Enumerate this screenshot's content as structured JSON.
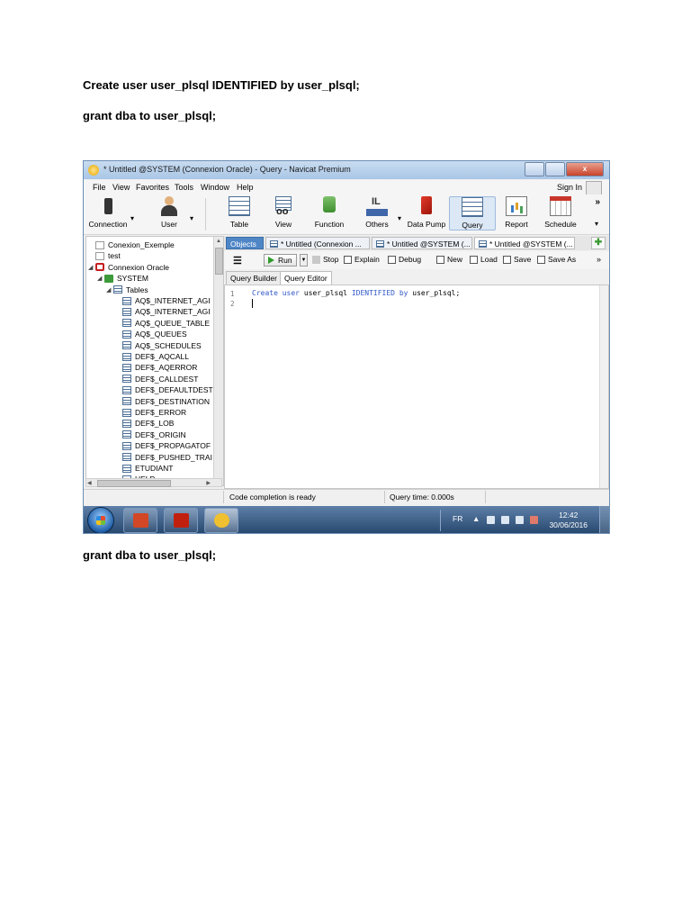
{
  "document": {
    "line1": "Create user user_plsql IDENTIFIED by user_plsql;",
    "line2": "grant dba to user_plsql;",
    "line3": "grant dba to user_plsql;"
  },
  "window": {
    "title": "* Untitled @SYSTEM (Connexion Oracle) - Query - Navicat Premium",
    "minimize": "",
    "maximize": "",
    "close": "x"
  },
  "menu": [
    "File",
    "View",
    "Favorites",
    "Tools",
    "Window",
    "Help"
  ],
  "signin": "Sign In",
  "more": "»",
  "toolbar": [
    "Connection",
    "User",
    "Table",
    "View",
    "Function",
    "Others",
    "Data Pump",
    "Query",
    "Report",
    "Schedule"
  ],
  "tree": [
    {
      "label": "Conexion_Exemple",
      "level": 0,
      "arrow": "",
      "icon": "connection-icon"
    },
    {
      "label": "test",
      "level": 0,
      "arrow": "",
      "icon": "connection-icon"
    },
    {
      "label": "Connexion Oracle",
      "level": 0,
      "arrow": "◢",
      "icon": "oracle-connection-icon"
    },
    {
      "label": "SYSTEM",
      "level": 1,
      "arrow": "◢",
      "icon": "schema-icon"
    },
    {
      "label": "Tables",
      "level": 2,
      "arrow": "◢",
      "icon": "tables-icon"
    },
    {
      "label": "AQ$_INTERNET_AGI",
      "level": 3,
      "arrow": "",
      "icon": "table-icon"
    },
    {
      "label": "AQ$_INTERNET_AGI",
      "level": 3,
      "arrow": "",
      "icon": "table-icon"
    },
    {
      "label": "AQ$_QUEUE_TABLE",
      "level": 3,
      "arrow": "",
      "icon": "table-icon"
    },
    {
      "label": "AQ$_QUEUES",
      "level": 3,
      "arrow": "",
      "icon": "table-icon"
    },
    {
      "label": "AQ$_SCHEDULES",
      "level": 3,
      "arrow": "",
      "icon": "table-icon"
    },
    {
      "label": "DEF$_AQCALL",
      "level": 3,
      "arrow": "",
      "icon": "table-icon"
    },
    {
      "label": "DEF$_AQERROR",
      "level": 3,
      "arrow": "",
      "icon": "table-icon"
    },
    {
      "label": "DEF$_CALLDEST",
      "level": 3,
      "arrow": "",
      "icon": "table-icon"
    },
    {
      "label": "DEF$_DEFAULTDEST",
      "level": 3,
      "arrow": "",
      "icon": "table-icon"
    },
    {
      "label": "DEF$_DESTINATION",
      "level": 3,
      "arrow": "",
      "icon": "table-icon"
    },
    {
      "label": "DEF$_ERROR",
      "level": 3,
      "arrow": "",
      "icon": "table-icon"
    },
    {
      "label": "DEF$_LOB",
      "level": 3,
      "arrow": "",
      "icon": "table-icon"
    },
    {
      "label": "DEF$_ORIGIN",
      "level": 3,
      "arrow": "",
      "icon": "table-icon"
    },
    {
      "label": "DEF$_PROPAGATOF",
      "level": 3,
      "arrow": "",
      "icon": "table-icon"
    },
    {
      "label": "DEF$_PUSHED_TRAI",
      "level": 3,
      "arrow": "",
      "icon": "table-icon"
    },
    {
      "label": "ETUDIANT",
      "level": 3,
      "arrow": "",
      "icon": "table-icon"
    },
    {
      "label": "HELP",
      "level": 3,
      "arrow": "",
      "icon": "table-icon"
    }
  ],
  "tabs": {
    "objects": "Objects",
    "tab1": "* Untitled (Connexion ...",
    "tab2": "* Untitled @SYSTEM (...",
    "tab3": "* Untitled @SYSTEM (..."
  },
  "query_toolbar": {
    "run": "Run",
    "stop": "Stop",
    "explain": "Explain",
    "debug": "Debug",
    "new": "New",
    "load": "Load",
    "save": "Save",
    "save_as": "Save As"
  },
  "subtabs": {
    "builder": "Query Builder",
    "editor": "Query Editor"
  },
  "editor": {
    "line_numbers": [
      "1",
      "2"
    ],
    "kw_create": "Create",
    "kw_user": "user",
    "ident1": "user_plsql",
    "kw_identified": "IDENTIFIED",
    "kw_by": "by",
    "ident2": "user_plsql;"
  },
  "status": {
    "left": "Code completion is ready",
    "right": "Query time: 0.000s"
  },
  "taskbar": {
    "lang": "FR",
    "time": "12:42",
    "date": "30/06/2016"
  }
}
